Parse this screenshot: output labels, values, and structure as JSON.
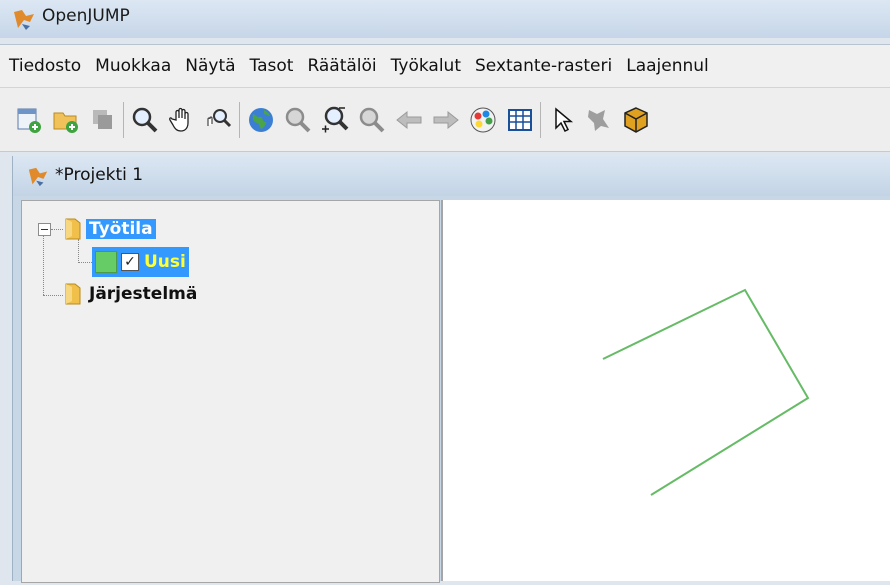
{
  "window": {
    "title": "OpenJUMP"
  },
  "menu": {
    "items": [
      "Tiedosto",
      "Muokkaa",
      "Näytä",
      "Tasot",
      "Räätälöi",
      "Työkalut",
      "Sextante-rasteri",
      "Laajennul"
    ]
  },
  "toolbar": {
    "buttons": [
      "new-project-icon",
      "add-layer-icon",
      "copy-layers-icon",
      "zoom-icon",
      "pan-hand-icon",
      "zoom-realtime-icon",
      "globe-icon",
      "zoom-to-extent-icon",
      "zoom-in-icon",
      "zoom-previous-icon",
      "back-arrow-icon",
      "forward-arrow-icon",
      "color-palette-icon",
      "grid-table-icon",
      "select-pointer-icon",
      "delete-feature-icon",
      "box-icon"
    ]
  },
  "project": {
    "title": "*Projekti 1"
  },
  "tree": {
    "workspace_label": "Työtila",
    "layer_label": "Uusi",
    "layer_checked": true,
    "system_label": "Järjestelmä"
  },
  "colors": {
    "selection": "#3399ff",
    "layer_green": "#66cc66",
    "geometry_stroke": "#66bb66"
  }
}
